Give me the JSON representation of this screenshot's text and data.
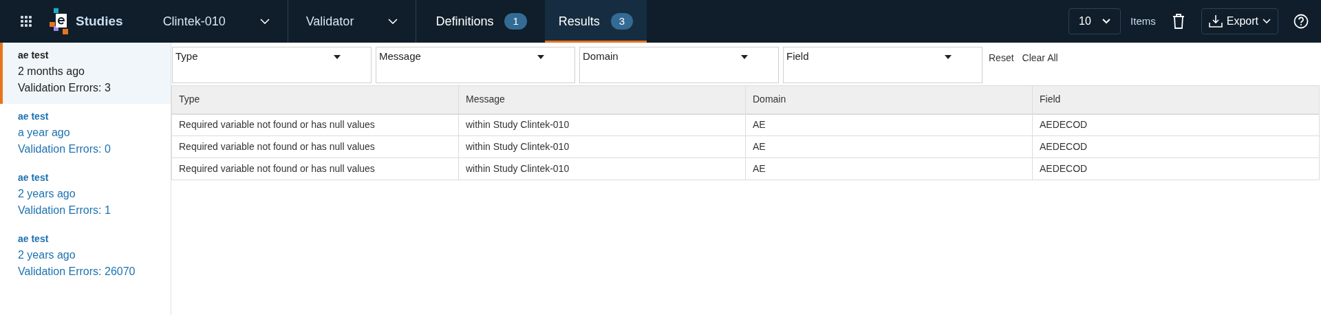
{
  "header": {
    "app_name": "Studies",
    "selectors": [
      {
        "label": "Clintek-010"
      },
      {
        "label": "Validator"
      }
    ],
    "tabs": [
      {
        "label": "Definitions",
        "count": "1",
        "selected": false
      },
      {
        "label": "Results",
        "count": "3",
        "selected": true
      }
    ],
    "page_size": "10",
    "items_label": "Items",
    "export_label": "Export"
  },
  "runs": [
    {
      "name": "ae test",
      "time": "2 months ago",
      "errors": "Validation Errors: 3",
      "selected": true
    },
    {
      "name": "ae test",
      "time": "a year ago",
      "errors": "Validation Errors: 0",
      "selected": false
    },
    {
      "name": "ae test",
      "time": "2 years ago",
      "errors": "Validation Errors: 1",
      "selected": false
    },
    {
      "name": "ae test",
      "time": "2 years ago",
      "errors": "Validation Errors: 26070",
      "selected": false
    }
  ],
  "filters": [
    {
      "label": "Type"
    },
    {
      "label": "Message"
    },
    {
      "label": "Domain"
    },
    {
      "label": "Field"
    }
  ],
  "filter_actions": [
    "Reset",
    "Clear All"
  ],
  "table": {
    "columns": [
      "Type",
      "Message",
      "Domain",
      "Field"
    ],
    "rows": [
      [
        "Required variable not found or has null values",
        "within Study Clintek-010",
        "AE",
        "AEDECOD"
      ],
      [
        "Required variable not found or has null values",
        "within Study Clintek-010",
        "AE",
        "AEDECOD"
      ],
      [
        "Required variable not found or has null values",
        "within Study Clintek-010",
        "AE",
        "AEDECOD"
      ]
    ]
  }
}
